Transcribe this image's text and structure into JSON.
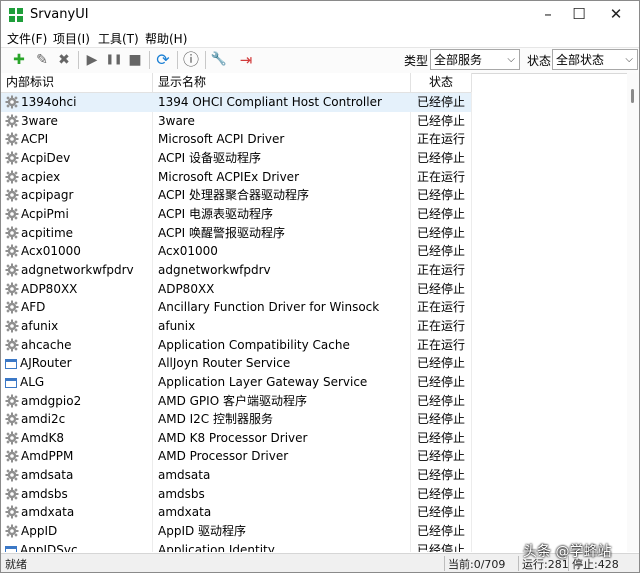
{
  "window": {
    "title": "SrvanyUI",
    "minimize": "–",
    "maximize": "☐",
    "close": "✕"
  },
  "menu": [
    "文件(F)",
    "项目(I)",
    "工具(T)",
    "帮助(H)"
  ],
  "toolbar": {
    "buttons": [
      {
        "name": "add-icon",
        "glyph": "✚",
        "color": "#2aa52a"
      },
      {
        "name": "edit-icon",
        "glyph": "✎",
        "color": "#666666"
      },
      {
        "name": "delete-icon",
        "glyph": "✖",
        "color": "#666666"
      },
      {
        "name": "play-icon",
        "glyph": "▶",
        "color": "#666666"
      },
      {
        "name": "pause-icon",
        "glyph": "❚❚",
        "color": "#666666"
      },
      {
        "name": "stop-icon",
        "glyph": "■",
        "color": "#666666"
      },
      {
        "name": "refresh-icon",
        "glyph": "⟳",
        "color": "#1a7fd4"
      },
      {
        "name": "info-icon",
        "glyph": "ⓘ",
        "color": "#555555"
      },
      {
        "name": "tools-icon",
        "glyph": "🔧",
        "color": "#3a6fb0"
      },
      {
        "name": "exit-icon",
        "glyph": "⇥",
        "color": "#d23b3b"
      }
    ],
    "type_label": "类型",
    "type_value": "全部服务",
    "status_label": "状态",
    "status_value": "全部状态"
  },
  "columns": [
    "内部标识",
    "显示名称",
    "状态"
  ],
  "rows": [
    {
      "id": "1394ohci",
      "name": "1394 OHCI Compliant Host Controller",
      "status": "已经停止",
      "icon": "gear",
      "selected": true
    },
    {
      "id": "3ware",
      "name": "3ware",
      "status": "已经停止",
      "icon": "gear"
    },
    {
      "id": "ACPI",
      "name": "Microsoft ACPI Driver",
      "status": "正在运行",
      "icon": "gear"
    },
    {
      "id": "AcpiDev",
      "name": "ACPI 设备驱动程序",
      "status": "已经停止",
      "icon": "gear"
    },
    {
      "id": "acpiex",
      "name": "Microsoft ACPIEx Driver",
      "status": "正在运行",
      "icon": "gear"
    },
    {
      "id": "acpipagr",
      "name": "ACPI 处理器聚合器驱动程序",
      "status": "已经停止",
      "icon": "gear"
    },
    {
      "id": "AcpiPmi",
      "name": "ACPI 电源表驱动程序",
      "status": "已经停止",
      "icon": "gear"
    },
    {
      "id": "acpitime",
      "name": "ACPI 唤醒警报驱动程序",
      "status": "已经停止",
      "icon": "gear"
    },
    {
      "id": "Acx01000",
      "name": "Acx01000",
      "status": "已经停止",
      "icon": "gear"
    },
    {
      "id": "adgnetworkwfpdrv",
      "name": "adgnetworkwfpdrv",
      "status": "正在运行",
      "icon": "gear"
    },
    {
      "id": "ADP80XX",
      "name": "ADP80XX",
      "status": "已经停止",
      "icon": "gear"
    },
    {
      "id": "AFD",
      "name": "Ancillary Function Driver for Winsock",
      "status": "正在运行",
      "icon": "gear"
    },
    {
      "id": "afunix",
      "name": "afunix",
      "status": "正在运行",
      "icon": "gear"
    },
    {
      "id": "ahcache",
      "name": "Application Compatibility Cache",
      "status": "正在运行",
      "icon": "gear"
    },
    {
      "id": "AJRouter",
      "name": "AllJoyn Router Service",
      "status": "已经停止",
      "icon": "window"
    },
    {
      "id": "ALG",
      "name": "Application Layer Gateway Service",
      "status": "已经停止",
      "icon": "window"
    },
    {
      "id": "amdgpio2",
      "name": "AMD GPIO 客户端驱动程序",
      "status": "已经停止",
      "icon": "gear"
    },
    {
      "id": "amdi2c",
      "name": "AMD I2C 控制器服务",
      "status": "已经停止",
      "icon": "gear"
    },
    {
      "id": "AmdK8",
      "name": "AMD K8 Processor Driver",
      "status": "已经停止",
      "icon": "gear"
    },
    {
      "id": "AmdPPM",
      "name": "AMD Processor Driver",
      "status": "已经停止",
      "icon": "gear"
    },
    {
      "id": "amdsata",
      "name": "amdsata",
      "status": "已经停止",
      "icon": "gear"
    },
    {
      "id": "amdsbs",
      "name": "amdsbs",
      "status": "已经停止",
      "icon": "gear"
    },
    {
      "id": "amdxata",
      "name": "amdxata",
      "status": "已经停止",
      "icon": "gear"
    },
    {
      "id": "AppID",
      "name": "AppID 驱动程序",
      "status": "已经停止",
      "icon": "gear"
    },
    {
      "id": "AppIDSvc",
      "name": "Application Identity",
      "status": "已经停止",
      "icon": "window"
    }
  ],
  "statusbar": {
    "state": "就绪",
    "position": "当前:0/709",
    "running": "运行:281",
    "stopped": "停止:428"
  },
  "watermark": "头条 @学蜂站",
  "colors": {
    "gear": "#8f8f8f",
    "selected_row": "#e5f1fb",
    "window_icon": "#3b78c6",
    "app_icon": "#1e9e3a"
  }
}
